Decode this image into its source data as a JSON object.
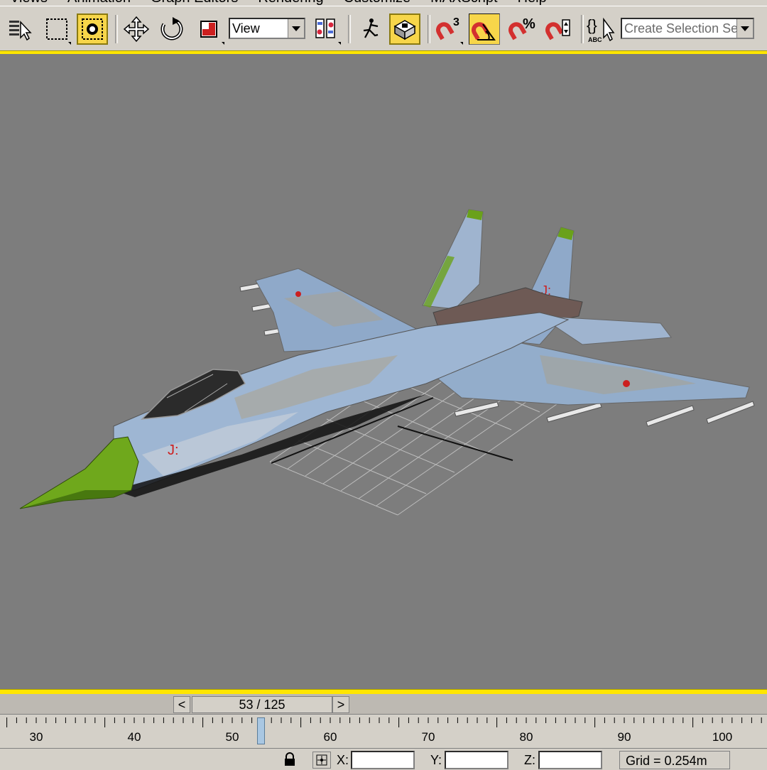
{
  "menubar": {
    "items": [
      "Views",
      "Animation",
      "Graph Editors",
      "Rendering",
      "Customize",
      "MAXScript",
      "Help"
    ]
  },
  "toolbar": {
    "reference_coord_value": "View",
    "selection_set_placeholder": "Create Selection Set",
    "snap_3d_label": "3",
    "percent_snap_label": "%",
    "named_sel_label": "ABC"
  },
  "time_slider": {
    "prev_label": "<",
    "next_label": ">",
    "frame_display": "53 / 125",
    "current_frame": 53,
    "total_frames": 125
  },
  "ruler": {
    "ticks": [
      "30",
      "40",
      "50",
      "60",
      "70",
      "80",
      "90",
      "100"
    ]
  },
  "status": {
    "x_label": "X:",
    "y_label": "Y:",
    "z_label": "Z:",
    "grid": "Grid = 0.254m"
  },
  "colors": {
    "ui_gray": "#d4d0c8",
    "viewport_bg": "#7d7d7d",
    "active_highlight": "#f7d64a",
    "active_border": "#ffe600"
  }
}
